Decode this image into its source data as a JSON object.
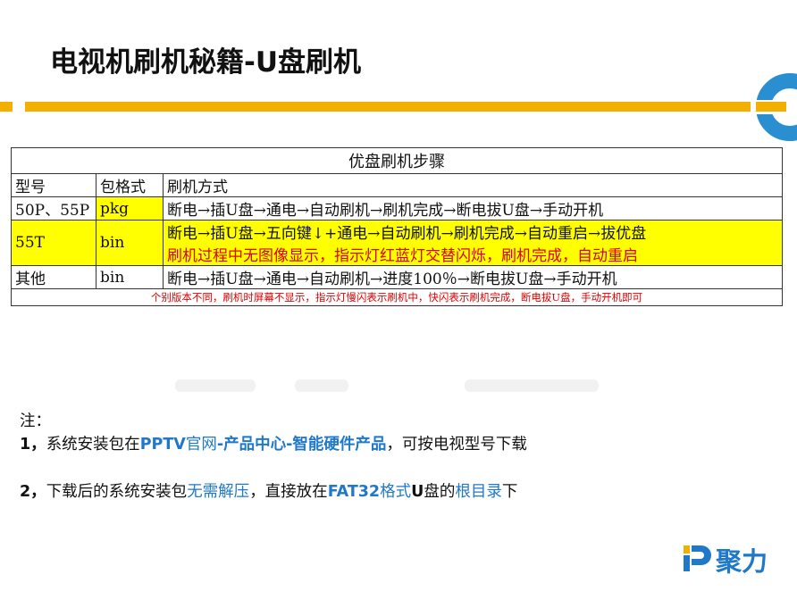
{
  "title": "电视机刷机秘籍-U盘刷机",
  "table": {
    "heading": "优盘刷机步骤",
    "columns": [
      "型号",
      "包格式",
      "刷机方式"
    ],
    "rows": [
      {
        "model": "50P、55P",
        "format": "pkg",
        "method": "断电→插U盘→通电→自动刷机→刷机完成→断电拔U盘→手动开机"
      },
      {
        "model": "55T",
        "format": "bin",
        "method": "断电→插U盘→五向键↓+通电→自动刷机→刷机完成→自动重启→拔优盘",
        "extra": "刷机过程中无图像显示，指示灯红蓝灯交替闪烁，刷机完成，自动重启"
      },
      {
        "model": "其他",
        "format": "bin",
        "method": "断电→插U盘→通电→自动刷机→进度100％→断电拔U盘→手动开机"
      }
    ],
    "footnote": "个别版本不同，刷机时屏幕不显示，指示灯慢闪表示刷机中，快闪表示刷机完成，断电拔U盘，手动开机即可"
  },
  "notes": {
    "label": "注：",
    "item1": {
      "num": "1，",
      "pre": "系统安装包在",
      "link1": "PPTV",
      "link2": "官网",
      "link3": "-产品中心-智能硬件产品",
      "post": "，可按电视型号下载"
    },
    "item2": {
      "num": "2，",
      "pre": "下载后的系统安装包",
      "hl1": "无需解压",
      "mid": "，直接放在",
      "hl2": "FAT32",
      "hl3": "格式",
      "bold": "U",
      "mid2": "盘的",
      "hl4": "根目录",
      "post": "下"
    }
  },
  "brand": {
    "name": "聚力",
    "mark": "P"
  },
  "colors": {
    "accent_bar": "#f4b000",
    "brand_blue": "#1f78c8",
    "highlight": "#ffff00",
    "warning_red": "#e00000"
  }
}
